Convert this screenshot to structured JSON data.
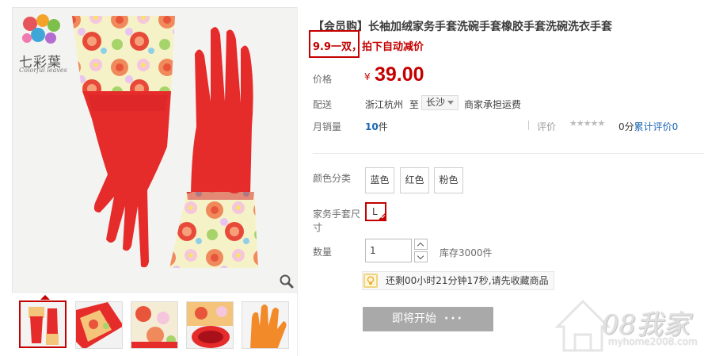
{
  "brand": {
    "name_cn": "七彩葉",
    "name_en": "Colorful leaves"
  },
  "product": {
    "title": "【会员购】长袖加绒家务手套洗碗手套橡胶手套洗碗洗衣手套",
    "promo": "9.9一双，拍下自动减价"
  },
  "price": {
    "label": "价格",
    "currency": "¥",
    "value": "39.00"
  },
  "shipping": {
    "label": "配送",
    "from": "浙江杭州",
    "sep": "至",
    "to": "长沙",
    "fee": "商家承担运费"
  },
  "sales": {
    "label": "月销量",
    "count": "10",
    "unit": "件"
  },
  "rating": {
    "label": "评价",
    "stars": "★★★★★",
    "score": "0分",
    "link": "累计评价0"
  },
  "color": {
    "label": "颜色分类",
    "options": [
      "蓝色",
      "红色",
      "粉色"
    ]
  },
  "size": {
    "label": "家务手套尺寸",
    "options": [
      "L"
    ],
    "selected": "L"
  },
  "quantity": {
    "label": "数量",
    "value": "1",
    "stock": "库存3000件"
  },
  "countdown": {
    "text": "还剩00小时21分钟17秒,请先收藏商品"
  },
  "buy": {
    "label": "即将开始",
    "dots": "···"
  },
  "thumbnails": [
    "red-gloves",
    "gloves-fan",
    "cuff-detail",
    "cuff-opening",
    "orange-glove"
  ],
  "watermark": {
    "text": "08我家",
    "url": "myhome2008.com"
  },
  "colors": {
    "accent": "#c40000",
    "link": "#1a66b3",
    "button": "#a9a9a9"
  }
}
